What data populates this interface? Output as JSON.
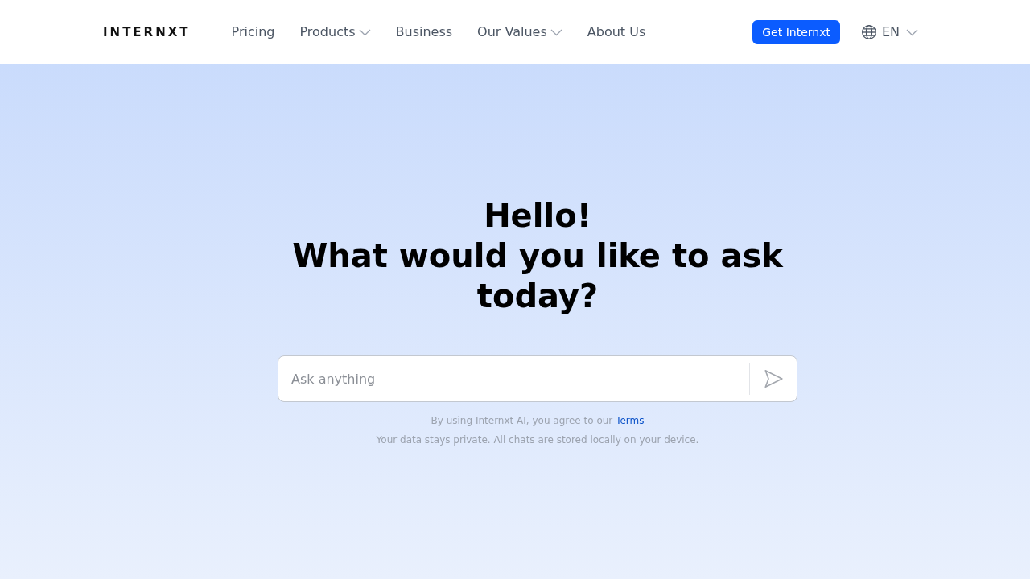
{
  "header": {
    "logo": "INTERNXT",
    "nav": [
      {
        "label": "Pricing",
        "has_menu": false
      },
      {
        "label": "Products",
        "has_menu": true
      },
      {
        "label": "Business",
        "has_menu": false
      },
      {
        "label": "Our Values",
        "has_menu": true
      },
      {
        "label": "About Us",
        "has_menu": false
      }
    ],
    "cta": "Get Internxt",
    "language": {
      "code": "EN",
      "has_menu": true
    }
  },
  "hero": {
    "title_lines": [
      "Hello!",
      "What would you like to ask today?"
    ],
    "prompt": {
      "placeholder": "Ask anything"
    },
    "terms": {
      "text": "By using Internxt AI, you agree to our",
      "link": "Terms"
    },
    "privacy_note": "Your data stays private. All chats are stored locally on your device."
  }
}
